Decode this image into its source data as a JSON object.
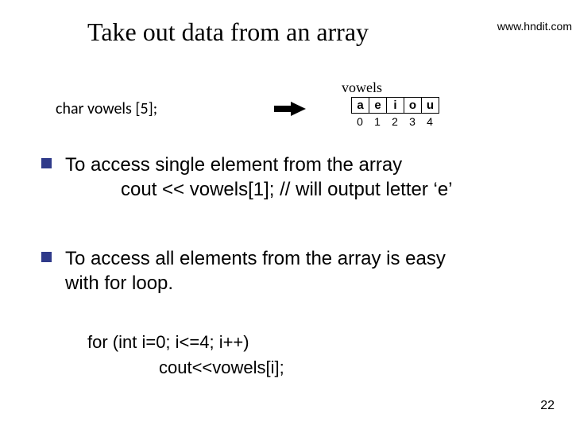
{
  "title": "Take out data from an array",
  "url": "www.hndit.com",
  "declaration": "char  vowels [5];",
  "array": {
    "label": "vowels",
    "cells": [
      "a",
      "e",
      "i",
      "o",
      "u"
    ],
    "indices": [
      "0",
      "1",
      "2",
      "3",
      "4"
    ]
  },
  "bullets": {
    "b1_line1": "To access single element from the array",
    "b1_line2": "cout << vowels[1];   // will output letter ‘e’",
    "b2_line1": "To access all elements from the array is easy",
    "b2_line2": "with for loop."
  },
  "forcode": {
    "line1": "for (int i=0; i<=4; i++)",
    "line2": "cout<<vowels[i];"
  },
  "page": "22"
}
